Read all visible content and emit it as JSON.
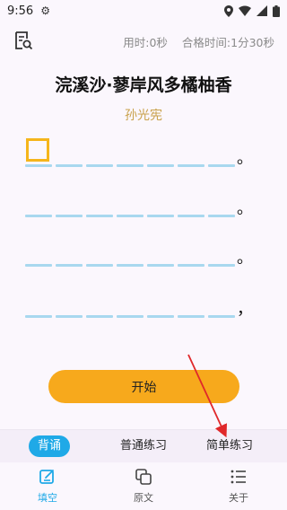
{
  "status_bar": {
    "time": "9:56"
  },
  "header": {
    "elapsed_label": "用时:0秒",
    "pass_time_label": "合格时间:1分30秒"
  },
  "poem": {
    "title": "浣溪沙·蓼岸风多橘柚香",
    "author": "孙光宪",
    "lines": [
      {
        "punct": "。"
      },
      {
        "punct": "。"
      },
      {
        "punct": "。"
      },
      {
        "punct": "，"
      }
    ]
  },
  "start_button": {
    "label": "开始"
  },
  "mode_tabs": [
    {
      "label": "背诵",
      "active": true
    },
    {
      "label": "普通练习",
      "active": false
    },
    {
      "label": "简单练习",
      "active": false
    }
  ],
  "bottom_nav": [
    {
      "label": "填空",
      "icon": "edit-square-icon",
      "active": true
    },
    {
      "label": "原文",
      "icon": "copy-icon",
      "active": false
    },
    {
      "label": "关于",
      "icon": "list-icon",
      "active": false
    }
  ],
  "colors": {
    "accent_blue": "#1fa9e7",
    "accent_orange": "#f7a91c",
    "author_gold": "#c9a14a",
    "blank_line": "#a8d8ef",
    "annotation_red": "#e0282a"
  }
}
